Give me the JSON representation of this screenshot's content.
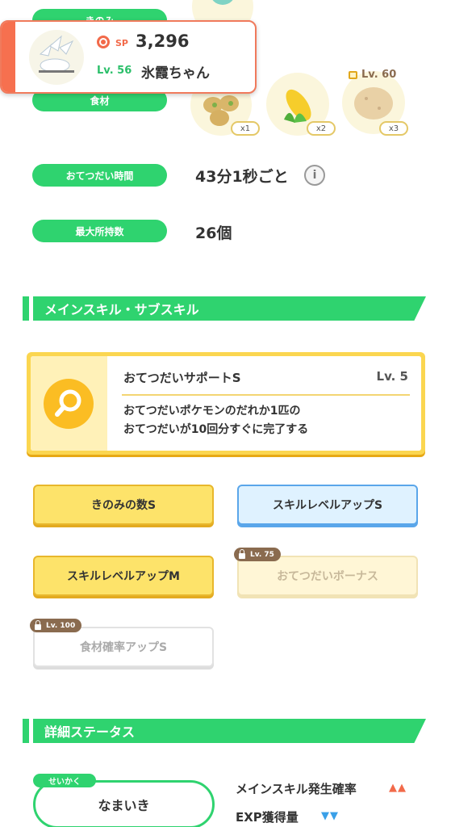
{
  "labels": {
    "berries": "きのみ",
    "ingredients": "食材",
    "help_time": "おてつだい時間",
    "max_carry": "最大所持数"
  },
  "values": {
    "help_time": "43分1秒ごと",
    "max_carry": "26個"
  },
  "ingredients": [
    {
      "name": "ingredient-1",
      "count": "x1"
    },
    {
      "name": "ingredient-2",
      "count": "x2"
    },
    {
      "name": "ingredient-3",
      "count": "x3",
      "lock_level": "Lv. 60"
    }
  ],
  "pokemon_card": {
    "sp_label": "SP",
    "sp_value": "3,296",
    "level": "Lv. 56",
    "name": "氷霞ちゃん"
  },
  "sections": {
    "skills": "メインスキル・サブスキル",
    "details": "詳細ステータス"
  },
  "main_skill": {
    "title": "おてつだいサポートS",
    "level": "Lv. 5",
    "desc_line1": "おてつだいポケモンのだれか1匹の",
    "desc_line2": "おてつだいが10回分すぐに完了する"
  },
  "sub_skills": [
    {
      "label": "きのみの数S"
    },
    {
      "label": "スキルレベルアップS"
    },
    {
      "label": "スキルレベルアップM"
    },
    {
      "label": "おてつだいボーナス",
      "lock": "Lv. 75"
    },
    {
      "label": "食材確率アップS",
      "lock": "Lv. 100"
    }
  ],
  "nature": {
    "tag": "せいかく",
    "value": "なまいき"
  },
  "stats": [
    {
      "label": "メインスキル発生確率",
      "arrows": "▲▲",
      "color": "#f26a4a"
    },
    {
      "label": "EXP獲得量",
      "arrows": "▼▼",
      "color": "#3aa0e8"
    }
  ],
  "info_icon": "i"
}
